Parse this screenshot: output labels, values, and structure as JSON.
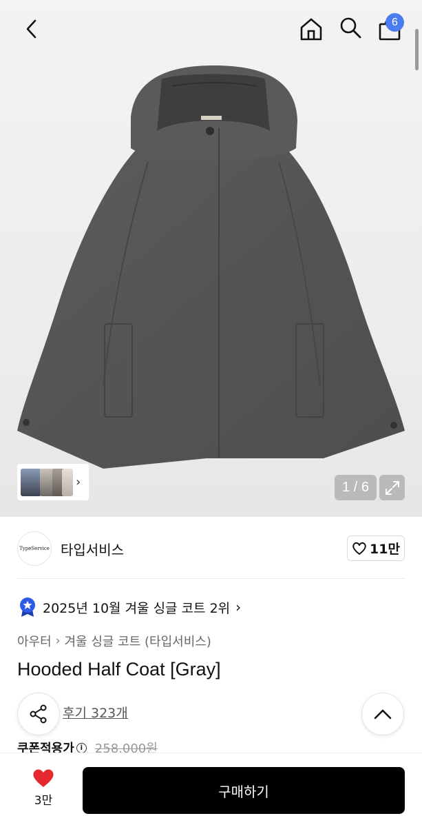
{
  "header": {
    "back_icon": "chevron-left-icon",
    "home_icon": "home-icon",
    "search_icon": "search-icon",
    "cart_icon": "shopping-bag-icon",
    "cart_count": "6",
    "badge_color": "#4a7df0"
  },
  "gallery": {
    "image": "gray hooded half coat product photo",
    "page_counter": "1 / 6",
    "expand_icon": "expand-arrows-icon",
    "thumbnail_arrow_icon": "chevron-right-icon"
  },
  "brand": {
    "logo_text": "TypeService",
    "name": "타입서비스",
    "like_icon": "heart-outline-icon",
    "like_count": "11만"
  },
  "ranking": {
    "badge_icon": "star-badge-icon",
    "text": "2025년 10월 겨울 싱글 코트 2위",
    "chevron": "›"
  },
  "breadcrumb": {
    "category": "아우터",
    "subcategory": "겨울 싱글 코트 (타입서비스)"
  },
  "product": {
    "title": "Hooded Half Coat [Gray]",
    "review_link": "후기 323개",
    "coupon_label": "쿠폰적용가",
    "original_price": "258,000원"
  },
  "bottom_bar": {
    "wish_icon": "heart-filled-icon",
    "wish_count": "3만",
    "buy_label": "구매하기",
    "wish_color": "#e5292f"
  }
}
